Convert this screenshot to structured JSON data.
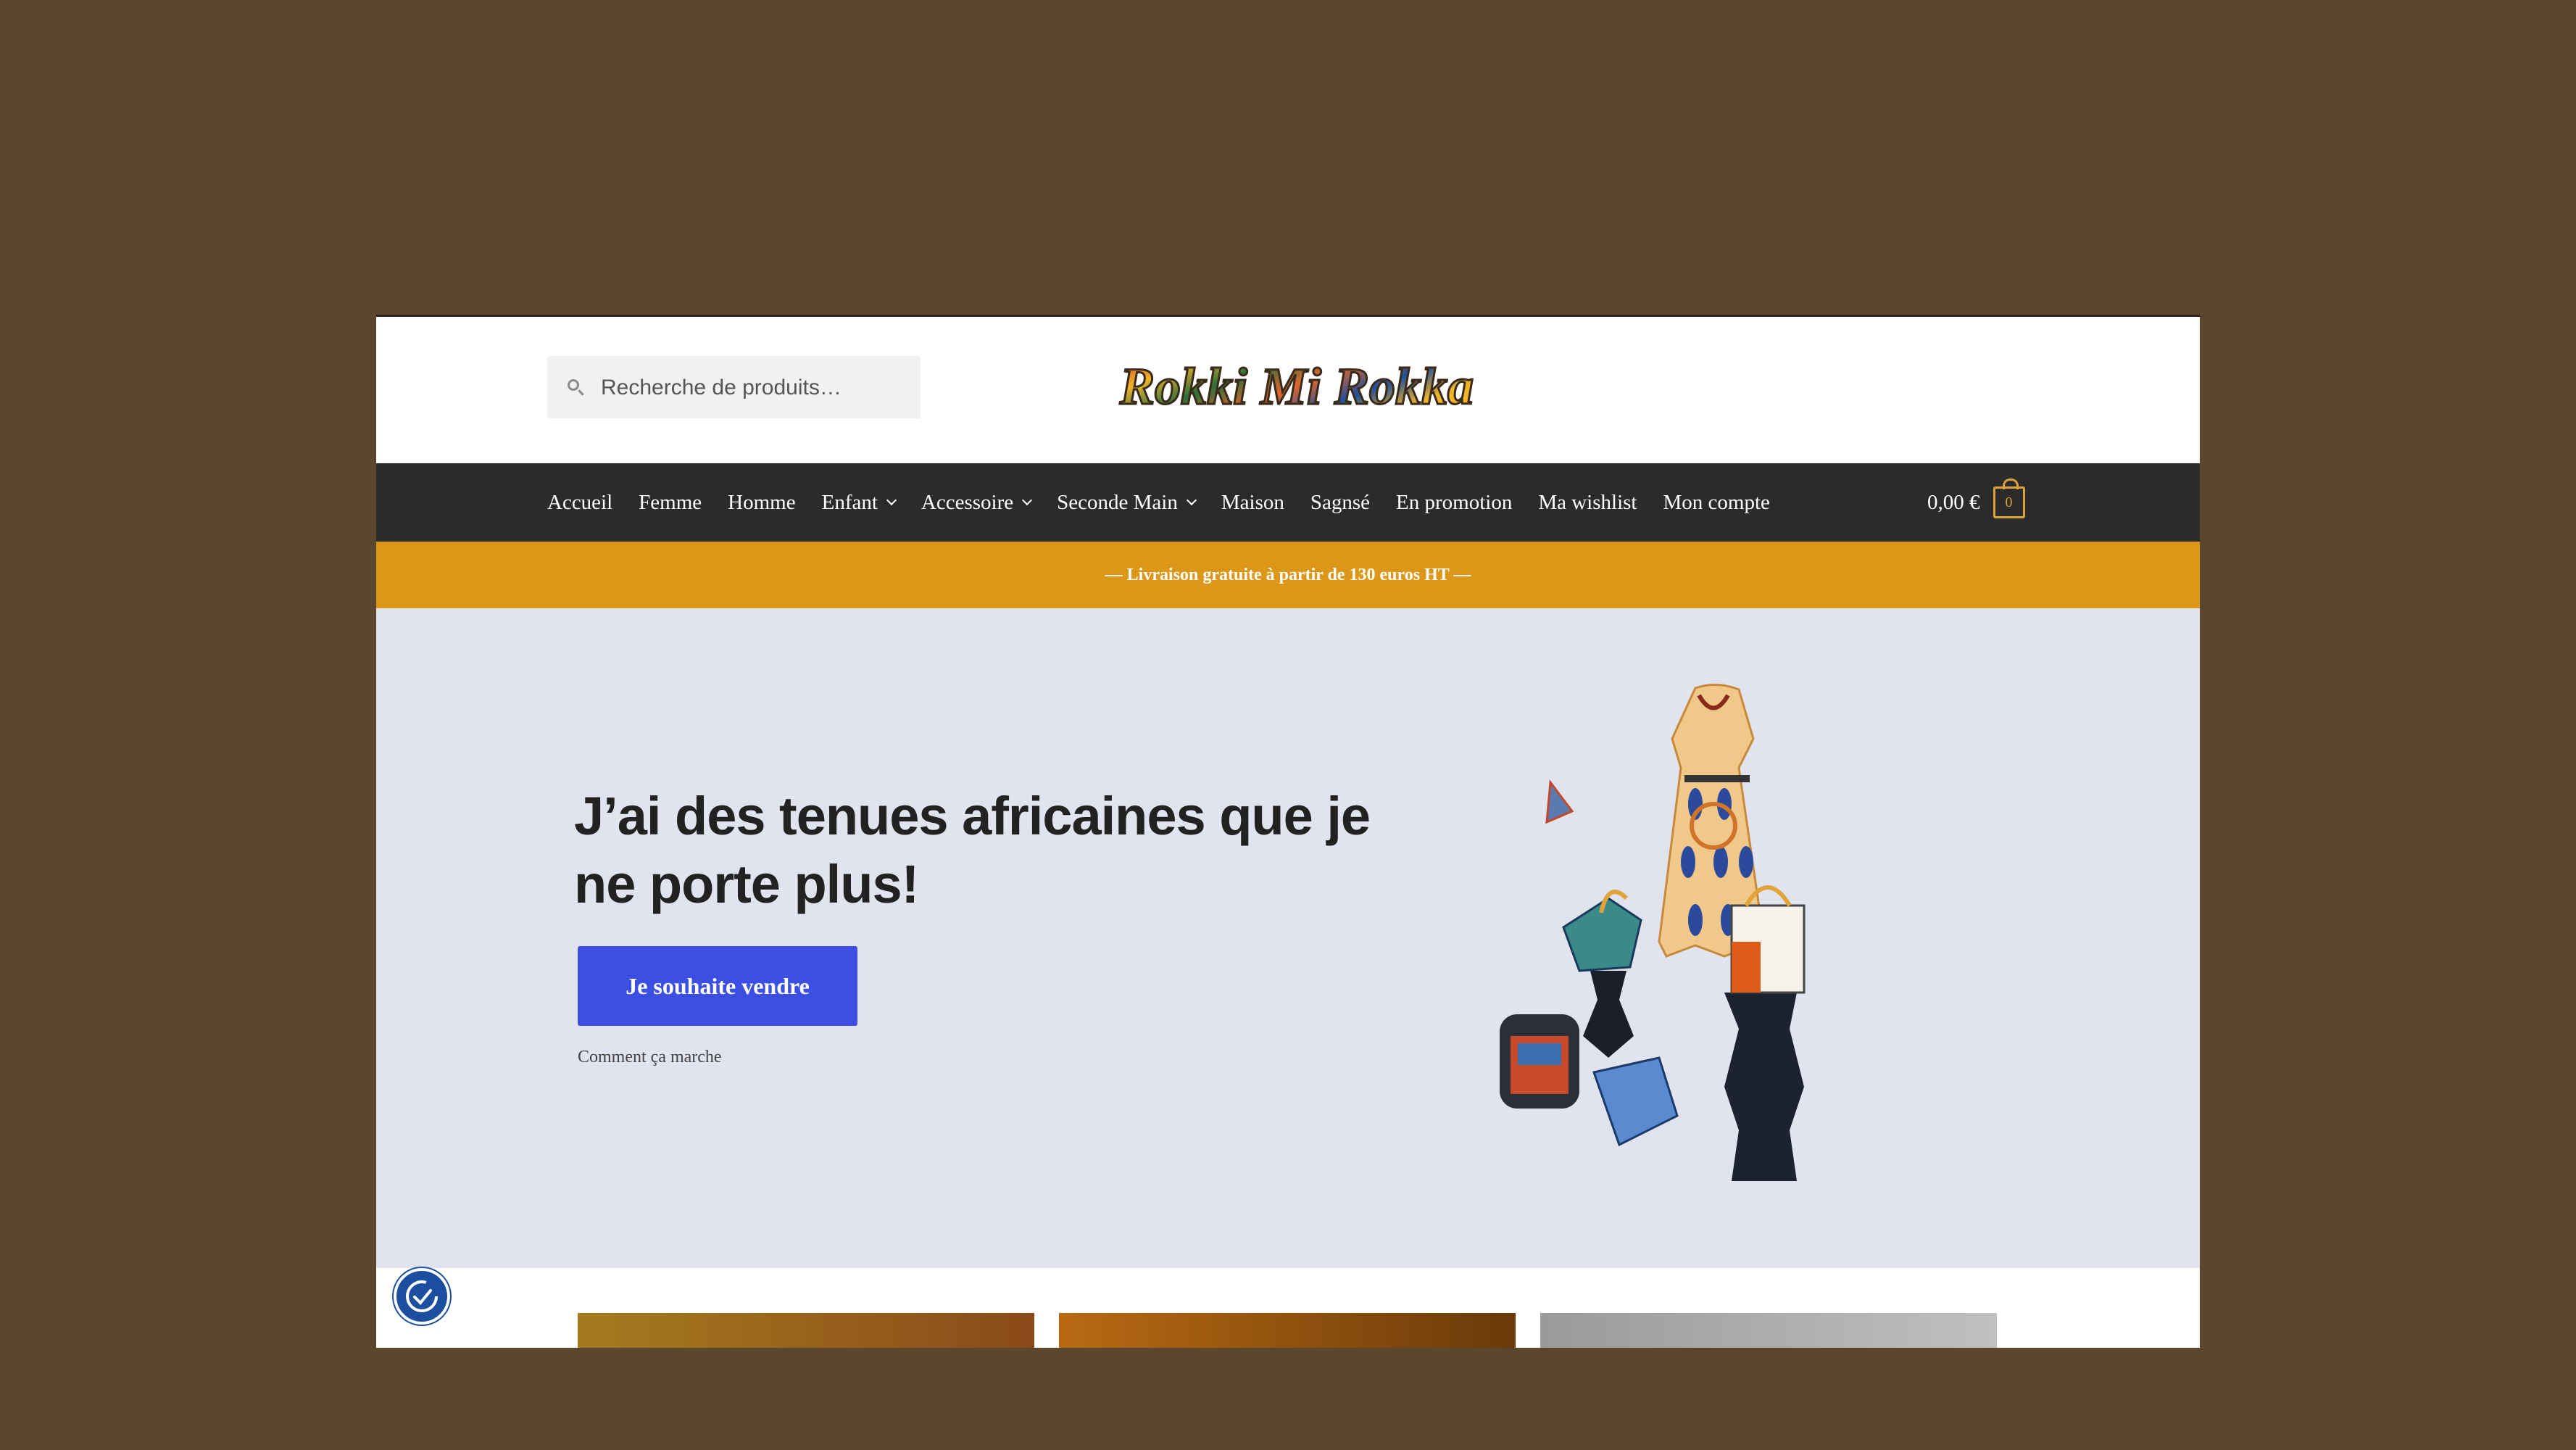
{
  "header": {
    "search_placeholder": "Recherche de produits…",
    "logo_text": "Rokki Mi Rokka"
  },
  "nav": {
    "items": [
      {
        "label": "Accueil",
        "has_dropdown": false
      },
      {
        "label": "Femme",
        "has_dropdown": false
      },
      {
        "label": "Homme",
        "has_dropdown": false
      },
      {
        "label": "Enfant",
        "has_dropdown": true
      },
      {
        "label": "Accessoire",
        "has_dropdown": true
      },
      {
        "label": "Seconde Main",
        "has_dropdown": true
      },
      {
        "label": "Maison",
        "has_dropdown": false
      },
      {
        "label": "Sagnsé",
        "has_dropdown": false
      },
      {
        "label": "En promotion",
        "has_dropdown": false
      },
      {
        "label": "Ma wishlist",
        "has_dropdown": false
      },
      {
        "label": "Mon compte",
        "has_dropdown": false
      }
    ],
    "cart_total": "0,00 €",
    "cart_count": "0"
  },
  "promo": {
    "text": "— Livraison gratuite à partir de 130 euros HT —"
  },
  "hero": {
    "headline": "J’ai des tenues africaines que je ne porte plus!",
    "cta_label": "Je souhaite vendre",
    "secondary_link": "Comment ça marche"
  },
  "colors": {
    "background": "#5b462e",
    "nav_bg": "#2b2b2b",
    "promo_bg": "#dc9719",
    "hero_bg": "#e1e4ee",
    "cta_bg": "#3b4fe2",
    "accent": "#dba23a"
  },
  "icons": [
    "search-icon",
    "chevron-down-icon",
    "cart-icon",
    "accessibility-icon"
  ]
}
